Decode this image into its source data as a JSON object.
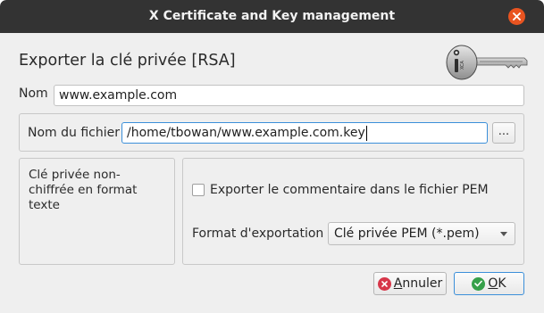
{
  "window": {
    "title": "X Certificate and Key management"
  },
  "dialog": {
    "heading": "Exporter la clé privée [RSA]"
  },
  "name_field": {
    "label": "Nom",
    "value": "www.example.com"
  },
  "file_field": {
    "label": "Nom du fichier",
    "value": "/home/tbowan/www.example.com.key",
    "browse_label": "..."
  },
  "description": "Clé privée non-chiffrée en format texte",
  "export_comment": {
    "label": "Exporter le commentaire dans le fichier PEM",
    "checked": false
  },
  "export_format": {
    "label": "Format d'exportation",
    "selected": "Clé privée PEM (*.pem)"
  },
  "buttons": {
    "cancel": "Annuler",
    "ok": "OK"
  },
  "colors": {
    "titlebar": "#333333",
    "close": "#e95420",
    "focus": "#3b8fd9",
    "cancel_icon": "#d7374a",
    "ok_icon": "#36a04a"
  }
}
